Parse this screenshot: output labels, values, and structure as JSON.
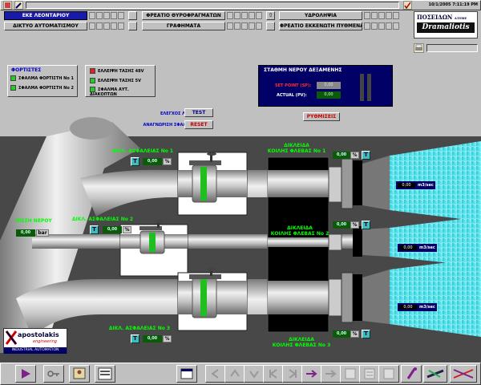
{
  "status": {
    "datetime": "10/1/2005 7:11:19 PM"
  },
  "nav": {
    "row1": [
      "ΕΚΕ ΛΕΟΝΤΑΡΙΟΥ",
      "ΦΡΕΑΤΙΟ ΘΥΡΟΦΡΑΓΜΑΤΩΝ",
      "ΥΔΡΟΛΗΨΙΑ"
    ],
    "row2": [
      "ΔΙΚΤΥΟ ΑΥΤΟΜΑΤΙΣΜΟΥ",
      "ΓΡΑΦΗΜΑΤΑ",
      "ΦΡΕΑΤΙΟ ΕΚΚΕΝΩΤΗ ΠΥΘΜΕΝΑ"
    ]
  },
  "brand": {
    "top": "ΠΟΣΕΙΔΩΝ",
    "side": "ΑΤΕΒΕ",
    "name": "Dramaliotis"
  },
  "legend": {
    "title": "ΦΟΡΤΙΣΤΕΣ",
    "items": [
      {
        "label": "ΣΦΑΛΜΑ ΦΟΡΤΙΣΤΗ Νο 1",
        "color": "#22cc22"
      },
      {
        "label": "ΣΦΑΛΜΑ ΦΟΡΤΙΣΤΗ Νο 2",
        "color": "#22cc22"
      },
      {
        "label": "ΕΛΛΕΙΨΗ ΤΑΣΗΣ 48V",
        "color": "#dd2222"
      },
      {
        "label": "ΕΛΛΕΙΨΗ ΤΑΣΗΣ 5V",
        "color": "#22cc22"
      },
      {
        "label": "ΣΦΑΛΜΑ ΑΥΤ. ΔΙΑΚΟΠΤΩΝ",
        "color": "#22cc22"
      }
    ]
  },
  "station": {
    "title": "ΣΤΑΘΜΗ ΝΕΡΟΥ ΔΕΞΑΜΕΝΗΣ",
    "setpoint_label": "SET POINT (SP):",
    "setpoint_value": "0,00",
    "actual_label": "ACTUAL (PV):",
    "actual_value": "0,00",
    "level_fraction": 0
  },
  "controls": {
    "lamp_test_label": "ΕΛΕΓΧΟΣ ΛΥΧΝΙΩΝ",
    "test_button": "TEST",
    "reset_label": "ΑΝΑΓΝΩΡΙΣΗ ΣΦΑΛΜΑΤΩΝ",
    "reset_button": "RESET",
    "settings_button": "ΡΥΘΜΙΣΕΙΣ"
  },
  "pressure": {
    "label": "ΠΙΕΣΗ ΝΕΡΟΥ",
    "value": "0,00",
    "unit": "bar"
  },
  "valves": {
    "v1": {
      "label": "ΔΙΚΛ. ΑΣΦΑΛΕΙΑΣ Νο 1",
      "value": "0,00",
      "unit": "%"
    },
    "v2": {
      "label": "ΔΙΚΛ. ΑΣΦΑΛΕΙΑΣ Νο 2",
      "value": "0,00",
      "unit": "%"
    },
    "v3": {
      "label": "ΔΙΚΛ. ΑΣΦΑΛΕΙΑΣ Νο 3",
      "value": "0,00",
      "unit": "%"
    }
  },
  "hollow": {
    "h1": {
      "label1": "ΔΙΚΛΕΙΔΑ",
      "label2": "ΚΟΙΛΗΣ ΦΛΕΒΑΣ Νο 1",
      "value": "0,00",
      "unit": "%"
    },
    "h2": {
      "label1": "ΔΙΚΛΕΙΔΑ",
      "label2": "ΚΟΙΛΗΣ ΦΛΕΒΑΣ Νο 2",
      "value": "0,00",
      "unit": "%"
    },
    "h3": {
      "label1": "ΔΙΚΛΕΙΔΑ",
      "label2": "ΚΟΙΛΗΣ ΦΛΕΒΑΣ Νο 3",
      "value": "0,00",
      "unit": "%"
    }
  },
  "flows": {
    "f1": {
      "value": "0,00",
      "unit": "m3/sec"
    },
    "f2": {
      "value": "0,00",
      "unit": "m3/sec"
    },
    "f3": {
      "value": "0,00",
      "unit": "m3/sec"
    }
  },
  "tbtn": "T",
  "logo": {
    "name": "apostolakis",
    "sub": "engineering",
    "footer": "INDUSTRIAL AUTOMATION"
  },
  "colors": {
    "water": "#33d5e0",
    "pipe": "#b8b8b8",
    "panel": "#000066",
    "bg": "#c0c0c0"
  }
}
